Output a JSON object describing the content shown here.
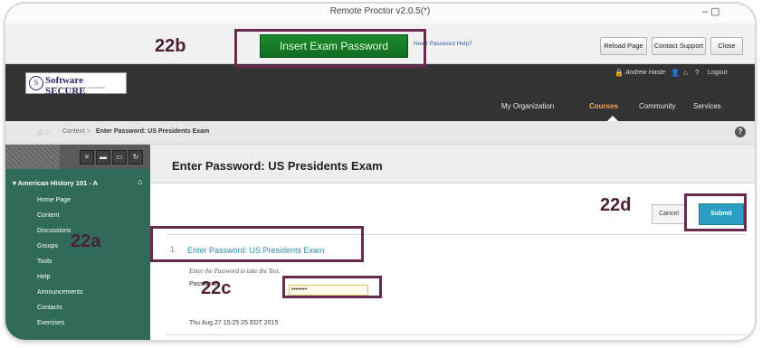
{
  "window": {
    "title": "Remote Proctor v2.0.5(*)",
    "controls": "–  ▢"
  },
  "proctor_toolbar": {
    "insert_password_label": "Insert Exam Password",
    "help_link": "Need Password Help?",
    "reload_label": "Reload Page",
    "support_label": "Contact Support",
    "close_label": "Close"
  },
  "header": {
    "logo_name": "Software SECURE",
    "logo_tagline": "SECURE TESTING ANYTIME ANYWHERE",
    "user_name": "Andrew Haste",
    "logout_label": "Logout",
    "nav": [
      "My Organization",
      "Courses",
      "Community",
      "Services"
    ],
    "active_tab": "Courses"
  },
  "breadcrumb": {
    "root": "Content",
    "separator": ">",
    "current": "Enter Password: US Presidents Exam"
  },
  "sidebar": {
    "course_title": "American History 101 - A",
    "items": [
      "Home Page",
      "Content",
      "Discussions",
      "Groups",
      "Tools",
      "Help",
      "Announcements",
      "Contacts",
      "Exercises"
    ]
  },
  "page": {
    "title": "Enter Password: US Presidents Exam",
    "cancel_label": "Cancel",
    "submit_label": "Submit",
    "question_number": "1.",
    "question_title": "Enter Password: US Presidents Exam",
    "instructions": "Enter the Password to take the Test.",
    "password_label": "Password",
    "password_value": "•••••••",
    "timestamp": "Thu Aug 27 15:25:25 EDT 2015"
  },
  "annotations": {
    "a": "22a",
    "b": "22b",
    "c": "22c",
    "d": "22d"
  },
  "colors": {
    "accent_green": "#1f8a2f",
    "submit_blue": "#2b9fc2",
    "sidebar_green": "#2f6a5a",
    "annotation": "#6b2a4d"
  }
}
